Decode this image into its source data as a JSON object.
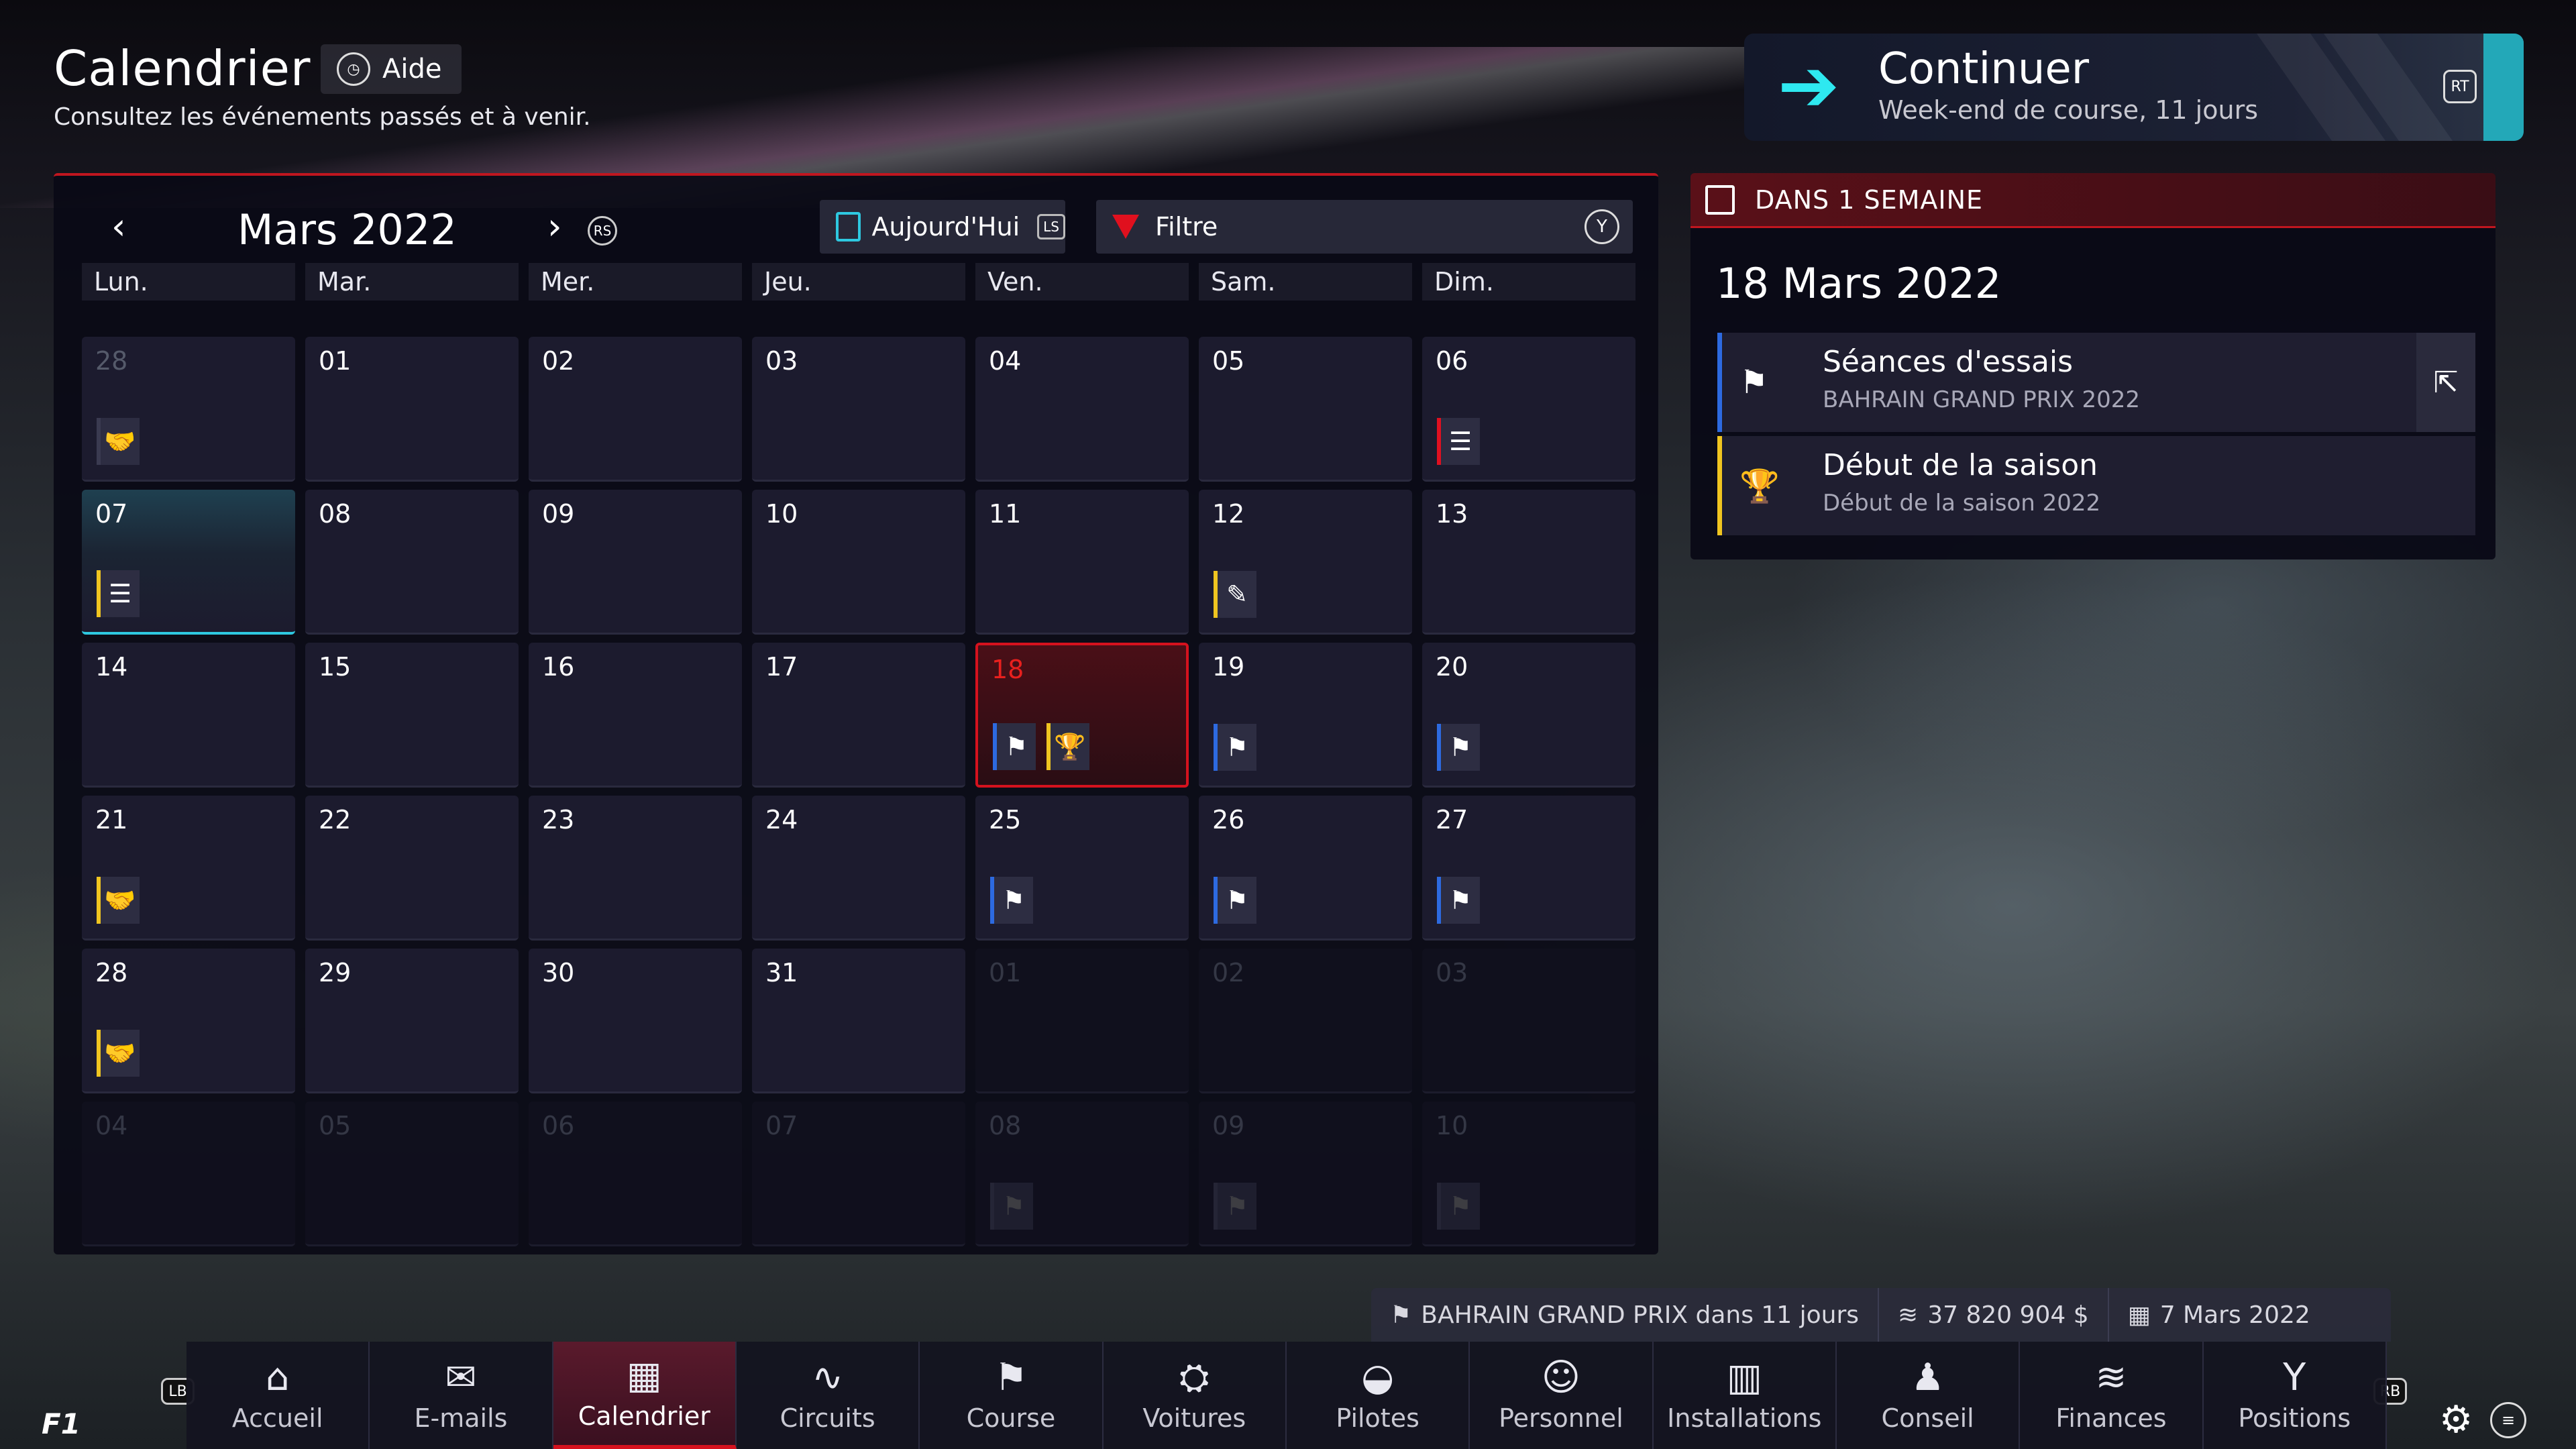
{
  "header": {
    "title": "Calendrier",
    "help_label": "Aide",
    "subtitle": "Consultez les événements passés et à venir."
  },
  "continue": {
    "label": "Continuer",
    "detail": "Week-end de course, 11 jours",
    "button": "RT"
  },
  "calendar": {
    "month_label": "Mars 2022",
    "prev_icon": "chevron-left-icon",
    "next_icon": "chevron-right-icon",
    "stick_label": "RS",
    "today_label": "Aujourd'Hui",
    "today_button": "LS",
    "filter_label": "Filtre",
    "filter_button": "Y",
    "weekdays": [
      "Lun.",
      "Mar.",
      "Mer.",
      "Jeu.",
      "Ven.",
      "Sam.",
      "Dim."
    ],
    "days": [
      {
        "n": "28",
        "faint": true,
        "events": [
          {
            "icon": "handshake",
            "color": "grey"
          }
        ]
      },
      {
        "n": "01"
      },
      {
        "n": "02"
      },
      {
        "n": "03"
      },
      {
        "n": "04"
      },
      {
        "n": "05"
      },
      {
        "n": "06",
        "events": [
          {
            "icon": "list",
            "color": "red"
          }
        ]
      },
      {
        "n": "07",
        "today": true,
        "events": [
          {
            "icon": "list",
            "color": "yellow"
          }
        ]
      },
      {
        "n": "08"
      },
      {
        "n": "09"
      },
      {
        "n": "10"
      },
      {
        "n": "11"
      },
      {
        "n": "12",
        "events": [
          {
            "icon": "tools",
            "color": "yellow"
          }
        ]
      },
      {
        "n": "13"
      },
      {
        "n": "14"
      },
      {
        "n": "15"
      },
      {
        "n": "16"
      },
      {
        "n": "17"
      },
      {
        "n": "18",
        "selected": true,
        "events": [
          {
            "icon": "flag",
            "color": "blue"
          },
          {
            "icon": "trophy",
            "color": "yellow"
          }
        ]
      },
      {
        "n": "19",
        "events": [
          {
            "icon": "flag",
            "color": "blue"
          }
        ]
      },
      {
        "n": "20",
        "events": [
          {
            "icon": "flag",
            "color": "blue"
          }
        ]
      },
      {
        "n": "21",
        "events": [
          {
            "icon": "handshake",
            "color": "yellow"
          }
        ]
      },
      {
        "n": "22"
      },
      {
        "n": "23"
      },
      {
        "n": "24"
      },
      {
        "n": "25",
        "events": [
          {
            "icon": "flag",
            "color": "blue"
          }
        ]
      },
      {
        "n": "26",
        "events": [
          {
            "icon": "flag",
            "color": "blue"
          }
        ]
      },
      {
        "n": "27",
        "events": [
          {
            "icon": "flag",
            "color": "blue"
          }
        ]
      },
      {
        "n": "28",
        "events": [
          {
            "icon": "handshake",
            "color": "yellow"
          }
        ]
      },
      {
        "n": "29"
      },
      {
        "n": "30"
      },
      {
        "n": "31"
      },
      {
        "n": "01",
        "faint": true,
        "dim": true
      },
      {
        "n": "02",
        "faint": true,
        "dim": true
      },
      {
        "n": "03",
        "faint": true,
        "dim": true
      },
      {
        "n": "04",
        "faint": true,
        "dim": true
      },
      {
        "n": "05",
        "faint": true,
        "dim": true
      },
      {
        "n": "06",
        "faint": true,
        "dim": true
      },
      {
        "n": "07",
        "faint": true,
        "dim": true
      },
      {
        "n": "08",
        "faint": true,
        "dim": true,
        "events": [
          {
            "icon": "flag",
            "color": "grey"
          }
        ]
      },
      {
        "n": "09",
        "faint": true,
        "dim": true,
        "events": [
          {
            "icon": "flag",
            "color": "grey"
          }
        ]
      },
      {
        "n": "10",
        "faint": true,
        "dim": true,
        "events": [
          {
            "icon": "flag",
            "color": "grey"
          }
        ]
      }
    ]
  },
  "side": {
    "header": "DANS 1 SEMAINE",
    "date": "18 Mars 2022",
    "events": [
      {
        "title": "Séances d'essais",
        "sub": "BAHRAIN GRAND PRIX 2022",
        "icon": "flag-icon",
        "color": "#2d6ae0"
      },
      {
        "title": "Début de la saison",
        "sub": "Début de la saison 2022",
        "icon": "trophy-icon",
        "color": "#f0c520"
      }
    ]
  },
  "status": {
    "race": "BAHRAIN GRAND PRIX dans 11 jours",
    "money": "37 820 904 $",
    "date": "7 Mars 2022"
  },
  "nav": {
    "left_bumper": "LB",
    "right_bumper": "RB",
    "items": [
      {
        "label": "Accueil",
        "icon": "home-icon"
      },
      {
        "label": "E-mails",
        "icon": "mail-icon"
      },
      {
        "label": "Calendrier",
        "icon": "calendar-icon",
        "active": true
      },
      {
        "label": "Circuits",
        "icon": "circuit-icon"
      },
      {
        "label": "Course",
        "icon": "race-flag-icon"
      },
      {
        "label": "Voitures",
        "icon": "car-icon"
      },
      {
        "label": "Pilotes",
        "icon": "helmet-icon"
      },
      {
        "label": "Personnel",
        "icon": "staff-icon"
      },
      {
        "label": "Installations",
        "icon": "facility-icon"
      },
      {
        "label": "Conseil",
        "icon": "board-icon"
      },
      {
        "label": "Finances",
        "icon": "finance-icon"
      },
      {
        "label": "Positions",
        "icon": "standings-icon"
      }
    ]
  },
  "colors": {
    "accent_red": "#d5121e",
    "accent_cyan": "#2ec8e0",
    "event_blue": "#2d6ae0",
    "event_yellow": "#f0c520"
  }
}
